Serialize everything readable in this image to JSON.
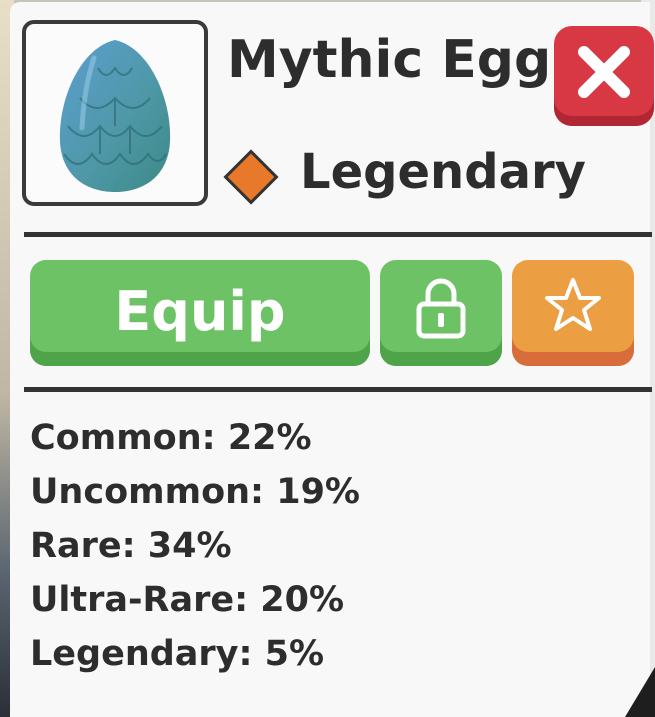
{
  "item": {
    "name": "Mythic Egg",
    "rarity": "Legendary",
    "icon": "dragon-egg-icon",
    "rarity_color": "#e8782a"
  },
  "actions": {
    "equip_label": "Equip",
    "lock_icon": "lock-icon",
    "favorite_icon": "star-icon",
    "close_icon": "close-icon"
  },
  "odds": [
    {
      "text": "Common: 22%",
      "rarity": "Common",
      "percent": 22
    },
    {
      "text": "Uncommon: 19%",
      "rarity": "Uncommon",
      "percent": 19
    },
    {
      "text": "Rare: 34%",
      "rarity": "Rare",
      "percent": 34
    },
    {
      "text": "Ultra-Rare: 20%",
      "rarity": "Ultra-Rare",
      "percent": 20
    },
    {
      "text": "Legendary: 5%",
      "rarity": "Legendary",
      "percent": 5
    }
  ],
  "colors": {
    "equip_green": "#6cc264",
    "close_red": "#d83844",
    "favorite_orange": "#ec9e42",
    "text_dark": "#2d2d2d"
  }
}
